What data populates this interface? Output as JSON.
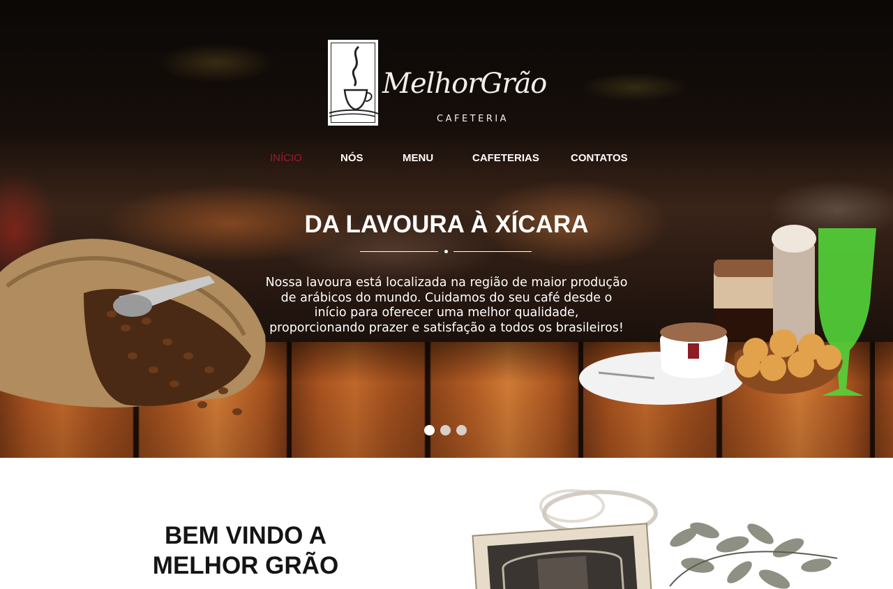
{
  "brand": {
    "name": "MelhorGrão",
    "subtitle": "CAFETERIA"
  },
  "nav": {
    "items": [
      {
        "label": "INÍCIO",
        "active": true
      },
      {
        "label": "NÓS"
      },
      {
        "label": "MENU"
      },
      {
        "label": "CAFETERIAS"
      },
      {
        "label": "CONTATOS"
      }
    ]
  },
  "hero": {
    "headline": "DA LAVOURA À XÍCARA",
    "tagline": "Nossa lavoura está localizada na região de maior produção de arábicos do mundo. Cuidamos do seu café desde o início para oferecer uma melhor qualidade, proporcionando prazer e satisfação a todos os brasileiros!",
    "slide_count": 3,
    "active_slide": 1
  },
  "welcome": {
    "title_line1": "BEM VINDO A",
    "title_line2": "MELHOR GRÃO"
  },
  "colors": {
    "accent": "#a0192c",
    "text_light": "#ffffff",
    "text_dark": "#141414"
  },
  "icons": [
    "coffee-cup-logo-icon",
    "slider-dot-icon"
  ]
}
